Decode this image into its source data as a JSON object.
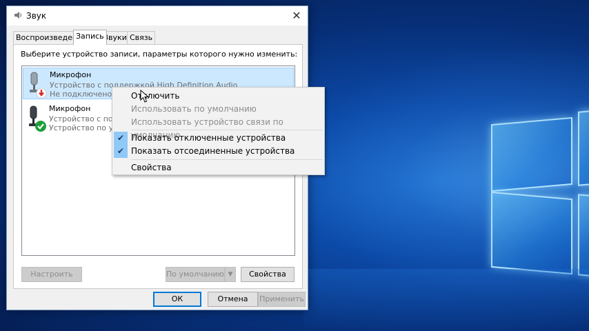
{
  "window": {
    "title": "Звук",
    "close_symbol": "✕"
  },
  "tabs": [
    {
      "label": "Воспроизведение",
      "active": false
    },
    {
      "label": "Запись",
      "active": true
    },
    {
      "label": "Звуки",
      "active": false
    },
    {
      "label": "Связь",
      "active": false
    }
  ],
  "instruction": "Выберите устройство записи, параметры которого нужно изменить:",
  "devices": [
    {
      "name": "Микрофон",
      "description": "Устройство с поддержкой High Definition Audio",
      "status": "Не подключено",
      "icon": "microphone-disconnected-icon",
      "selected": true
    },
    {
      "name": "Микрофон",
      "description": "Устройство с подде",
      "status": "Устройство по умолч",
      "icon": "microphone-default-icon",
      "selected": false
    }
  ],
  "context_menu": {
    "items": [
      {
        "label": "Отключить",
        "enabled": true,
        "checked": false
      },
      {
        "label": "Использовать по умолчанию",
        "enabled": false,
        "checked": false
      },
      {
        "label": "Использовать устройство связи по умолчанию",
        "enabled": false,
        "checked": false
      },
      {
        "label": "Показать отключенные устройства",
        "enabled": true,
        "checked": true
      },
      {
        "label": "Показать отсоединенные устройства",
        "enabled": true,
        "checked": true
      },
      {
        "label": "Свойства",
        "enabled": true,
        "checked": false
      }
    ],
    "check_symbol": "✔"
  },
  "panel_buttons": {
    "configure": "Настроить",
    "set_default": "По умолчанию",
    "set_default_arrow": "▼",
    "properties": "Свойства"
  },
  "dialog_buttons": {
    "ok": "ОК",
    "cancel": "Отмена",
    "apply": "Применить"
  },
  "colors": {
    "selection": "#cce8ff",
    "accent": "#0078d7",
    "status_error": "#d32f2f",
    "status_ok": "#1e9e3a"
  }
}
